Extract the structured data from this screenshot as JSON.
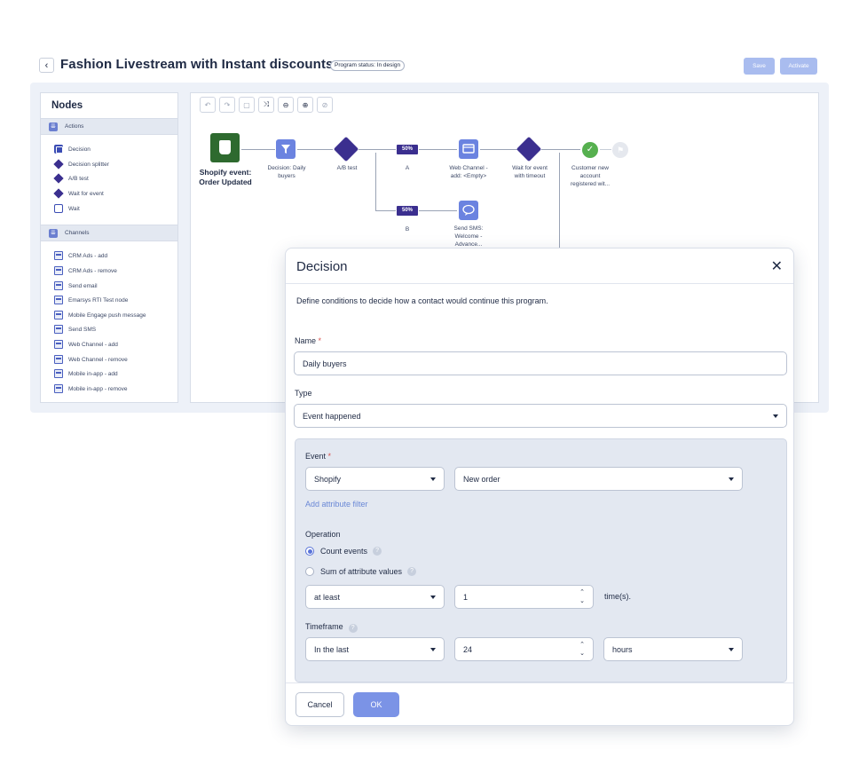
{
  "header": {
    "title": "Fashion Livestream with Instant discounts",
    "status": "Program status: In design",
    "save_label": "Save",
    "activate_label": "Activate"
  },
  "nodes_panel": {
    "title": "Nodes",
    "sections": [
      {
        "label": "Actions",
        "items": [
          "Decision",
          "Decision splitter",
          "A/B test",
          "Wait for event",
          "Wait"
        ]
      },
      {
        "label": "Channels",
        "items": [
          "CRM Ads - add",
          "CRM Ads - remove",
          "Send email",
          "Emarsys RTI Test node",
          "Mobile Engage push message",
          "Send SMS",
          "Web Channel - add",
          "Web Channel - remove",
          "Mobile in-app - add",
          "Mobile in-app - remove"
        ]
      }
    ]
  },
  "canvas": {
    "nodes": {
      "shopify": [
        "Shopify event:",
        "Order Updated"
      ],
      "decision": [
        "Decision: Daily",
        "buyers"
      ],
      "ab_test": "A/B test",
      "pct_a": "50%",
      "pct_b": "50%",
      "branch_a": "A",
      "branch_b": "B",
      "web_channel": [
        "Web Channel -",
        "add: <Empty>"
      ],
      "wait_event": [
        "Wait for event",
        "with timeout"
      ],
      "customer": [
        "Customer new",
        "account",
        "registered wit..."
      ],
      "sms": [
        "Send SMS:",
        "Welcome -",
        "Advance..."
      ]
    }
  },
  "dialog": {
    "title": "Decision",
    "description": "Define conditions to decide how a contact would continue this program.",
    "name_label": "Name",
    "name_value": "Daily buyers",
    "type_label": "Type",
    "type_value": "Event happened",
    "event_label": "Event",
    "event_source": "Shopify",
    "event_value": "New order",
    "add_filter": "Add attribute filter",
    "operation_label": "Operation",
    "operation_options": [
      "Count events",
      "Sum of attribute values"
    ],
    "operation_selected": "Count events",
    "operator_value": "at least",
    "count_value": "1",
    "count_unit": "time(s).",
    "timeframe_label": "Timeframe",
    "timeframe_mode": "In the last",
    "timeframe_amount": "24",
    "timeframe_unit": "hours",
    "cancel_label": "Cancel",
    "ok_label": "OK"
  },
  "colors": {
    "accent": "#6b83e0",
    "primary_button": "#7b93e6",
    "node_purple": "#3b2f8f",
    "shopify_green": "#2e6a2f"
  }
}
